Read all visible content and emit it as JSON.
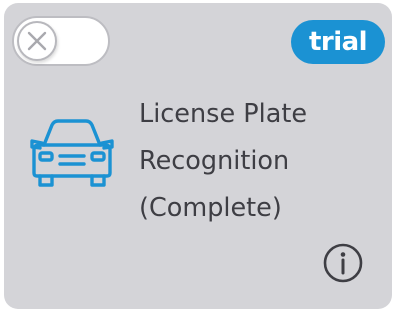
{
  "card": {
    "badge": "trial",
    "title_lines": [
      "License Plate",
      "Recognition",
      "(Complete)"
    ],
    "toggle_state": "off",
    "icons": {
      "toggle_knob": "close-x-icon",
      "main": "car-icon",
      "info": "info-icon"
    }
  },
  "colors": {
    "card_background": "#d4d4d8",
    "accent_blue": "#1b92d3",
    "text": "#3e3e44"
  }
}
